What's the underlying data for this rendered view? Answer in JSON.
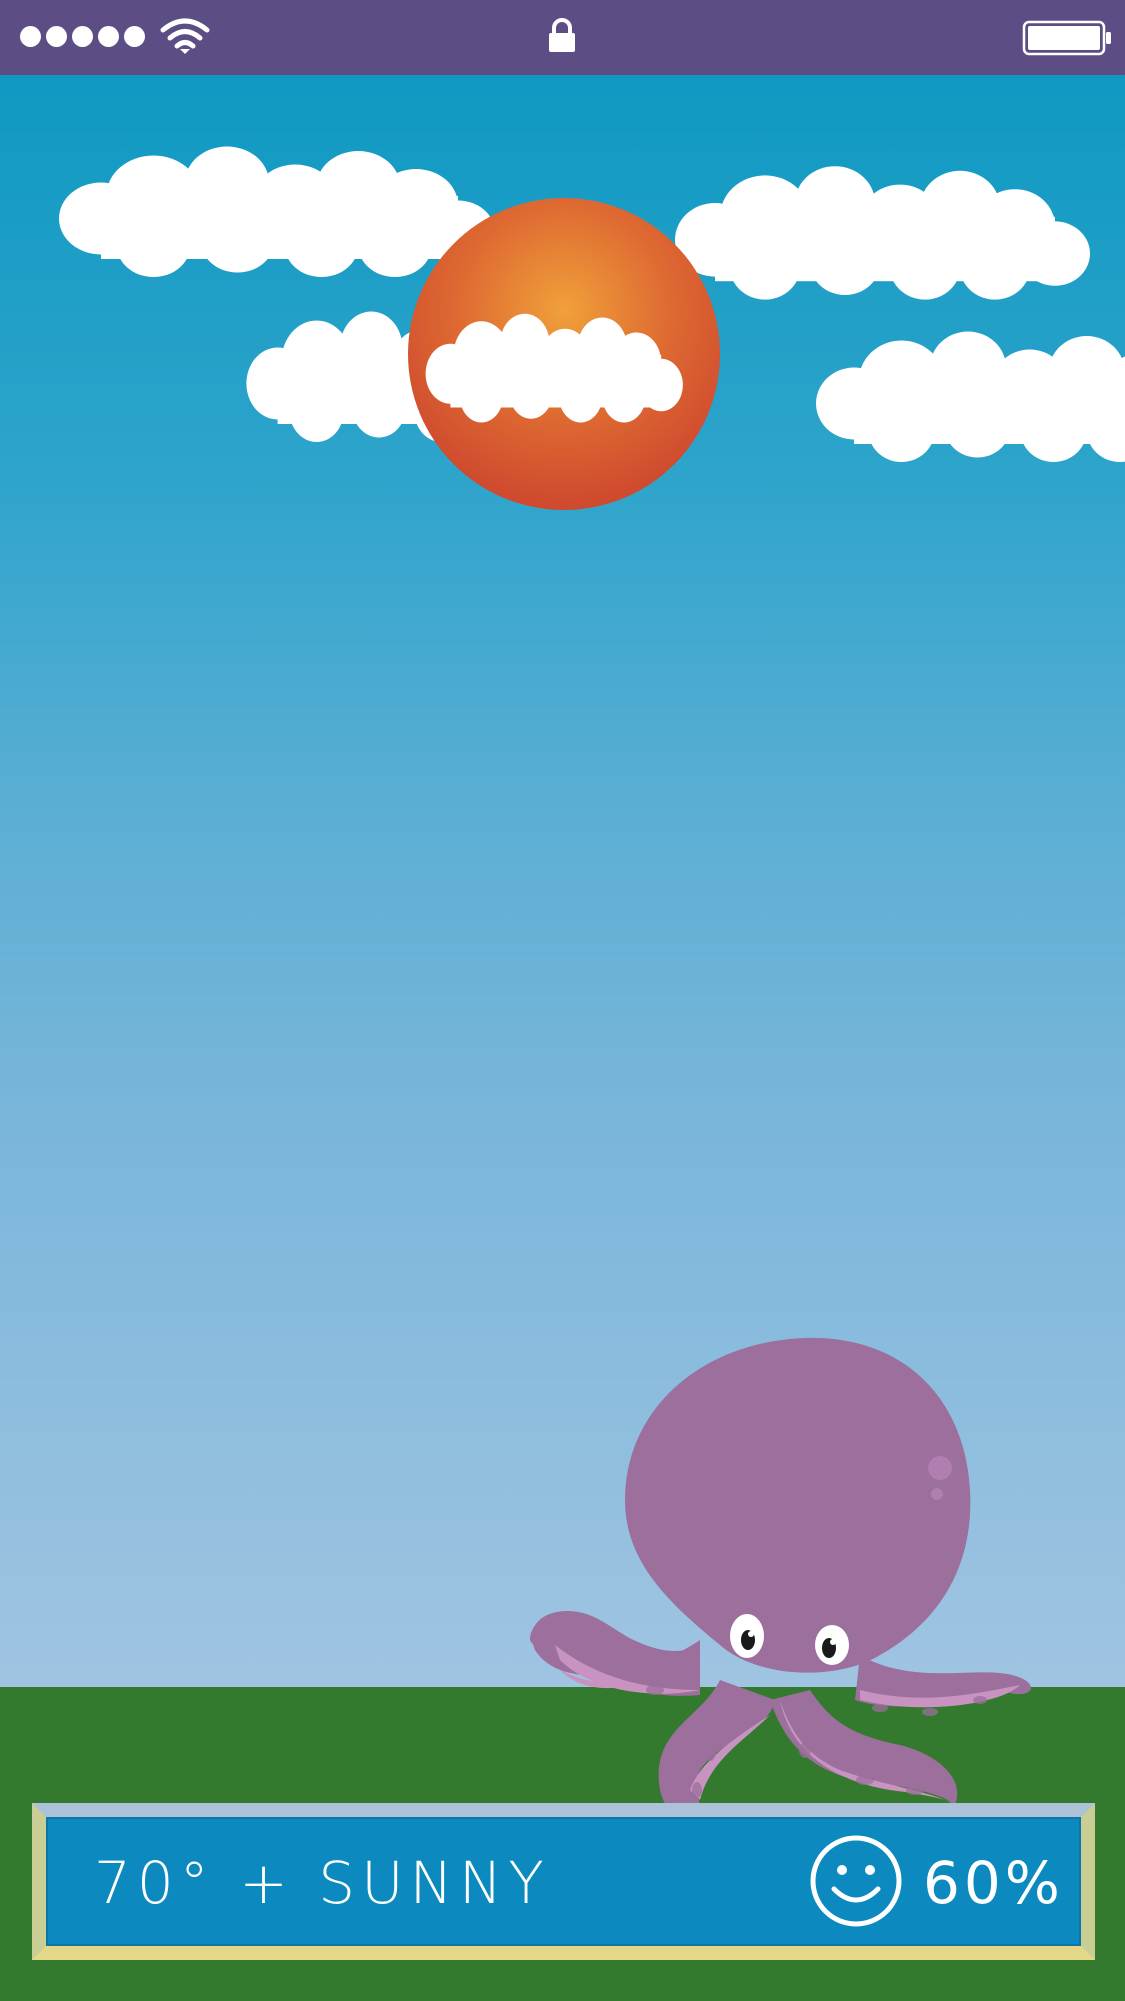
{
  "status_bar": {
    "signal_icon": "signal-dots-icon",
    "wifi_icon": "wifi-icon",
    "lock_icon": "lock-icon",
    "battery_icon": "battery-icon",
    "signal_bars": 5,
    "battery_level": 1.0
  },
  "scene": {
    "sun_icon": "sun-icon",
    "cloud_icon": "cloud-icon",
    "character": "octopus",
    "colors": {
      "status_bar": "#5c4e85",
      "sky_top": "#0f99c2",
      "sky_bottom": "#a0c4e2",
      "ground": "#337a2e",
      "sun_outer": "#cf4a2e",
      "sun_inner": "#f0a03a",
      "octopus": "#9c6f9c",
      "tentacle_underside": "#c893c0"
    }
  },
  "info_bar": {
    "weather_text": "70° + SUNNY",
    "mood_icon": "smiley-icon",
    "percent_text": "60%",
    "colors": {
      "panel": "#0c8ac0",
      "frame": "#e2d887"
    }
  }
}
